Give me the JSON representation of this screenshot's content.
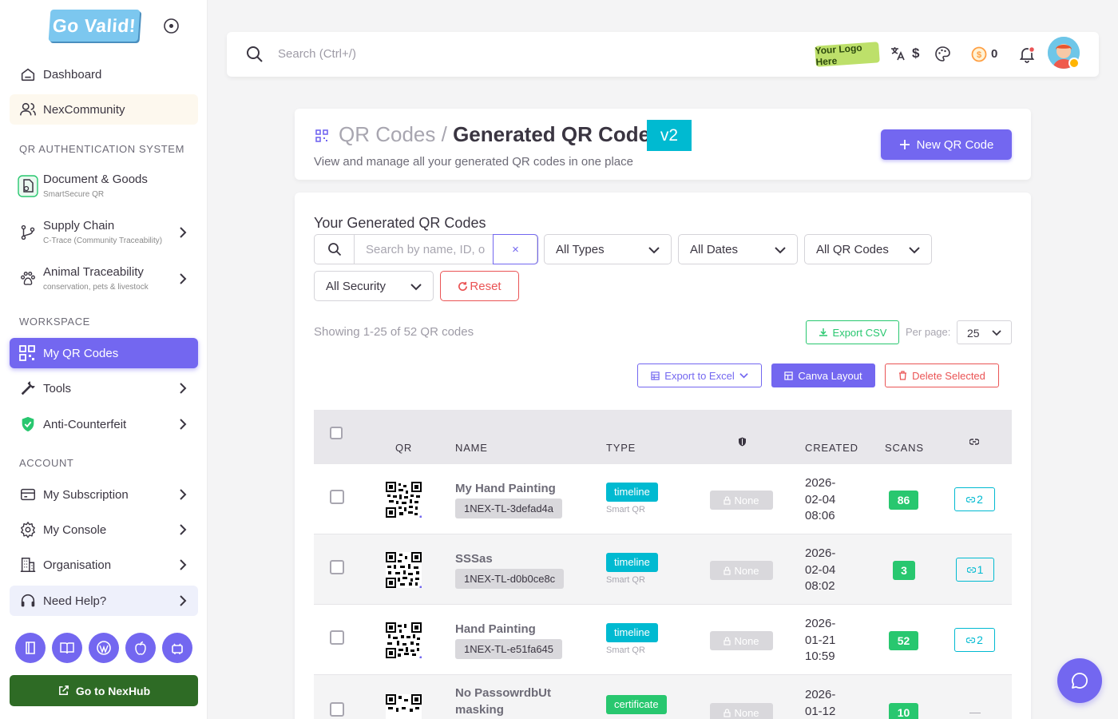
{
  "brand": {
    "logo_text": "Go Valid!"
  },
  "sidebar": {
    "items": [
      {
        "label": "Dashboard"
      },
      {
        "label": "NexCommunity"
      },
      {
        "label": "Document & Goods",
        "sub": "SmartSecure QR"
      },
      {
        "label": "Supply Chain",
        "sub": "C-Trace (Community Traceability)"
      },
      {
        "label": "Animal Traceability",
        "sub": "conservation, pets & livestock"
      },
      {
        "label": "My QR Codes"
      },
      {
        "label": "Tools"
      },
      {
        "label": "Anti-Counterfeit"
      },
      {
        "label": "My Subscription"
      },
      {
        "label": "My Console"
      },
      {
        "label": "Organisation"
      },
      {
        "label": "Need Help?"
      }
    ],
    "sections": {
      "qr_auth": "QR AUTHENTICATION SYSTEM",
      "workspace": "WORKSPACE",
      "account": "ACCOUNT"
    },
    "nexhub_label": "Go to NexHub"
  },
  "topbar": {
    "search_placeholder": "Search (Ctrl+/)",
    "your_logo": "Your Logo Here",
    "currency_symbol": "$",
    "coin_count": "0"
  },
  "header": {
    "breadcrumb_parent": "QR Codes /",
    "title": "Generated QR Codes",
    "version_badge": "v2",
    "subtitle": "View and manage all your generated QR codes in one place",
    "new_button": "New QR Code"
  },
  "filters": {
    "heading": "Your Generated QR Codes",
    "search_placeholder": "Search by name, ID, or URL",
    "clear_label": "×",
    "types": "All Types",
    "dates": "All Dates",
    "qr_codes": "All QR Codes",
    "security": "All Security",
    "reset": "Reset"
  },
  "listing": {
    "showing": "Showing 1-25 of 52 QR codes",
    "export_csv": "Export CSV",
    "per_page_label": "Per page:",
    "per_page_value": "25",
    "export_excel": "Export to Excel",
    "canva_layout": "Canva Layout",
    "delete_selected": "Delete Selected"
  },
  "table": {
    "columns": {
      "qr": "QR",
      "name": "NAME",
      "type": "TYPE",
      "created": "CREATED",
      "scans": "SCANS"
    },
    "rows": [
      {
        "name": "My Hand Painting",
        "id": "1NEX-TL-3defad4a",
        "type": "timeline",
        "subtype": "Smart QR",
        "security": "None",
        "created_date": "2026-",
        "created_md": "02-04",
        "created_time": "08:06",
        "scans": "86",
        "shares": "2"
      },
      {
        "name": "SSSas",
        "id": "1NEX-TL-d0b0ce8c",
        "type": "timeline",
        "subtype": "Smart QR",
        "security": "None",
        "created_date": "2026-",
        "created_md": "02-04",
        "created_time": "08:02",
        "scans": "3",
        "shares": "1"
      },
      {
        "name": "Hand Painting",
        "id": "1NEX-TL-e51fa645",
        "type": "timeline",
        "subtype": "Smart QR",
        "security": "None",
        "created_date": "2026-",
        "created_md": "01-21",
        "created_time": "10:59",
        "scans": "52",
        "shares": "2"
      },
      {
        "name_line1": "No PassowrdbUt",
        "name_line2": "masking",
        "type": "certificate",
        "security": "None",
        "created_date": "2026-",
        "created_md": "01-12",
        "scans": "10",
        "shares": "—"
      }
    ]
  },
  "colors": {
    "primary": "#7367f0",
    "info": "#00bad1",
    "success": "#28c76f",
    "danger": "#ea5455",
    "hub_green": "#2e6b25"
  }
}
